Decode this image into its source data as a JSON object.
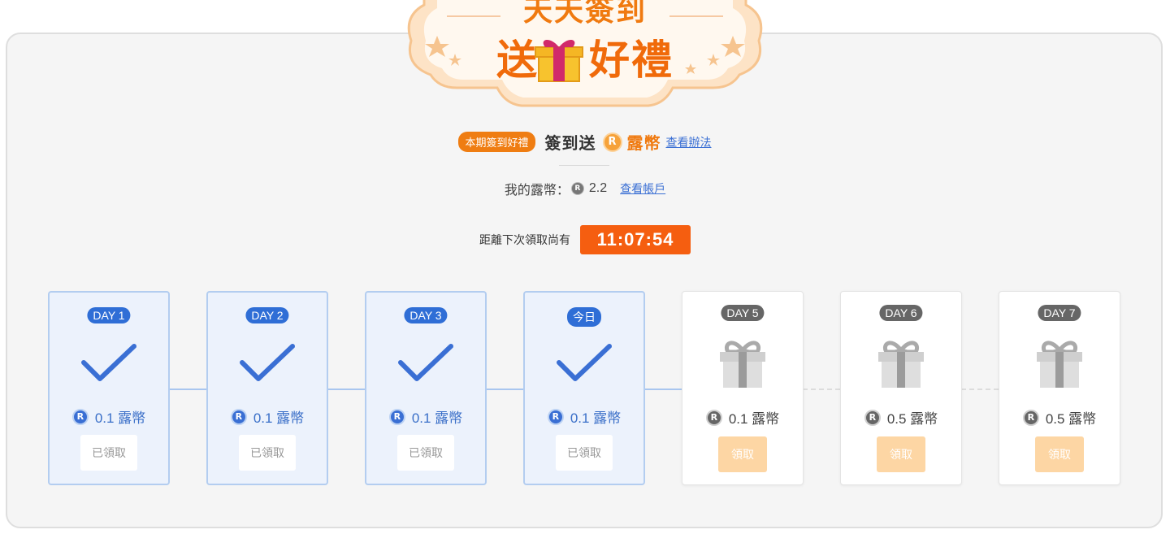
{
  "banner": {
    "line1": "天天簽到",
    "line2_left": "送",
    "line2_right": "好禮"
  },
  "promo": {
    "badge": "本期簽到好禮",
    "title": "簽到送",
    "coin_symbol": "R",
    "coin_name": "露幣",
    "link": "查看辦法"
  },
  "balance": {
    "label": "我的露幣：",
    "coin_symbol": "R",
    "value": "2.2",
    "link": "查看帳戶"
  },
  "countdown": {
    "label": "距離下次領取尚有",
    "time": "11:07:54"
  },
  "days": [
    {
      "tag": "DAY 1",
      "amount": "0.1 露幣",
      "button": "已領取",
      "status": "claimed"
    },
    {
      "tag": "DAY 2",
      "amount": "0.1 露幣",
      "button": "已領取",
      "status": "claimed"
    },
    {
      "tag": "DAY 3",
      "amount": "0.1 露幣",
      "button": "已領取",
      "status": "claimed"
    },
    {
      "tag": "今日",
      "amount": "0.1 露幣",
      "button": "已領取",
      "status": "claimed"
    },
    {
      "tag": "DAY 5",
      "amount": "0.1 露幣",
      "button": "領取",
      "status": "pending"
    },
    {
      "tag": "DAY 6",
      "amount": "0.5 露幣",
      "button": "領取",
      "status": "pending"
    },
    {
      "tag": "DAY 7",
      "amount": "0.5 露幣",
      "button": "領取",
      "status": "pending"
    }
  ],
  "colors": {
    "accent_orange": "#f07a10",
    "timer_bg": "#f55e10",
    "claimed_blue": "#2f6ed6",
    "pending_button": "#fdd6a4"
  },
  "icons": {
    "claimed": "checkmark-icon",
    "pending": "gift-icon",
    "coin": "r-coin-icon"
  }
}
